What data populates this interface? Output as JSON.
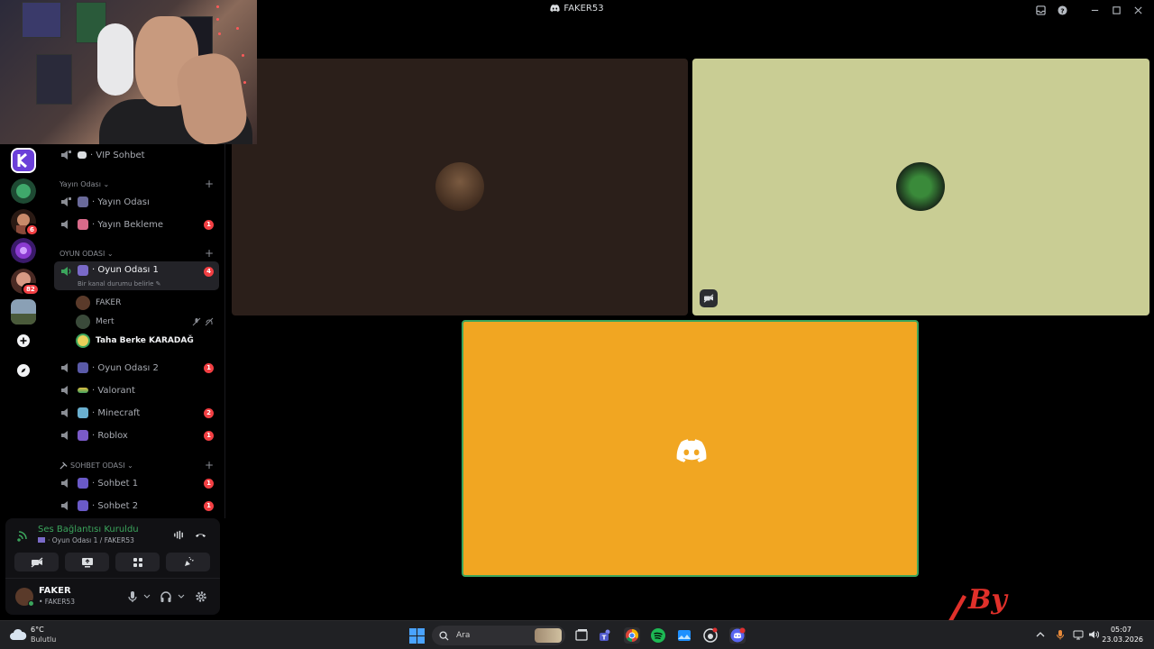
{
  "window": {
    "title": "FAKER53"
  },
  "guilds": [
    {
      "name": "K",
      "color": "#7b4dff",
      "badge": ""
    },
    {
      "name": "green",
      "color": "#2f6b45",
      "badge": ""
    },
    {
      "name": "girl",
      "color": "#b06a4a",
      "badge": "6"
    },
    {
      "name": "purple",
      "color": "#6a2fa0",
      "badge": ""
    },
    {
      "name": "face",
      "color": "#b57a6a",
      "badge": "82"
    },
    {
      "name": "landscape",
      "color": "#7d8a9a",
      "badge": ""
    }
  ],
  "guild_actions": {
    "add_icon": "plus-icon",
    "discover_icon": "compass-icon"
  },
  "channels": {
    "vip": {
      "label": "· VIP Sohbet"
    },
    "yayin_category": {
      "label": "Yayın Odası ⌄"
    },
    "yayin_odasi": {
      "label": "· Yayın Odası"
    },
    "yayin_bekleme": {
      "label": "· Yayın Bekleme",
      "badge": "1"
    },
    "oyun_category": {
      "label": "OYUN ODASI ⌄"
    },
    "oyun_odasi_1": {
      "label": "· Oyun Odası 1",
      "badge": "4",
      "status": "Bir kanal durumu belirle ✎"
    },
    "members": [
      {
        "name": "FAKER",
        "color": "#5a3a2a"
      },
      {
        "name": "Mert",
        "color": "#3a4a3a"
      },
      {
        "name": "Taha Berke KARADAĞ",
        "color": "#e8d15a"
      }
    ],
    "oyun_odasi_2": {
      "label": "· Oyun Odası 2",
      "badge": "1"
    },
    "valorant": {
      "label": "· Valorant"
    },
    "minecraft": {
      "label": "· Minecraft",
      "badge": "2"
    },
    "roblox": {
      "label": "· Roblox",
      "badge": "1"
    },
    "sohbet_category": {
      "label": "SOHBET ODASI ⌄"
    },
    "sohbet_1": {
      "label": "· Sohbet 1",
      "badge": "1"
    },
    "sohbet_2": {
      "label": "· Sohbet 2",
      "badge": "1"
    }
  },
  "voice": {
    "status": "Ses Bağlantısı Kuruldu",
    "channel": "· Oyun Odası 1 / FAKER53"
  },
  "user": {
    "name": "FAKER",
    "subtitle": "• FAKER53"
  },
  "stage": {
    "tile1_color": "#2b1f1a",
    "tile2_color": "#c9cd94",
    "tile3_color": "#f1a622",
    "speaking_border": "#3ba55c"
  },
  "taskbar": {
    "temp": "6°C",
    "weather": "Bulutlu",
    "search": "Ara",
    "time": "05:07",
    "date": "23.03.2026"
  },
  "watermark": "By"
}
